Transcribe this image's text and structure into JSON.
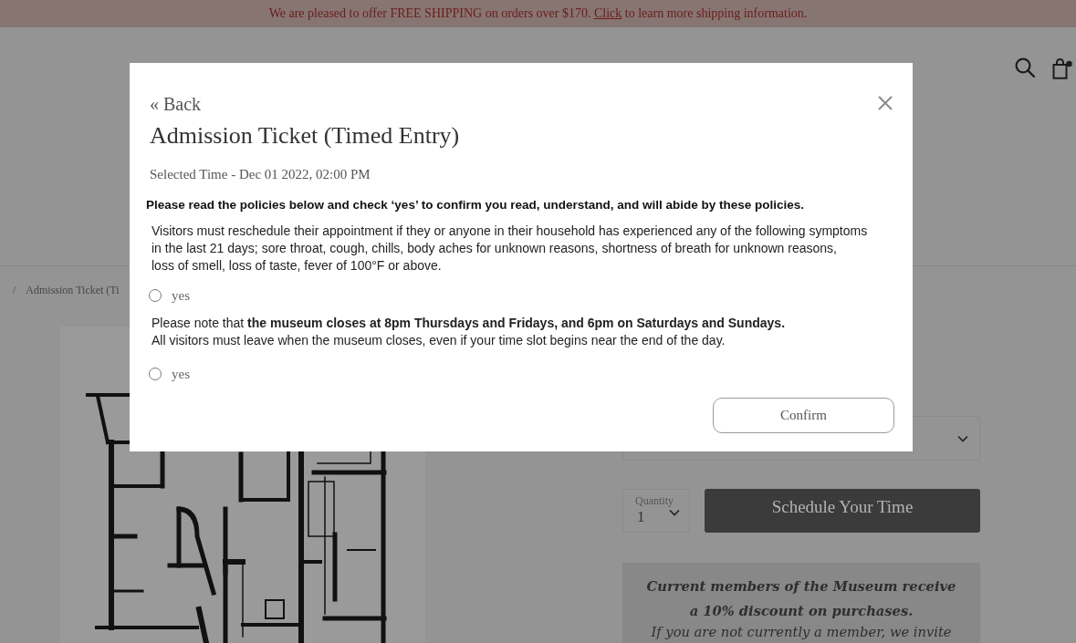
{
  "announcement": {
    "before": "We are pleased to offer FREE SHIPPING on orders over $170.",
    "link": "Click",
    "after": "to learn more shipping information."
  },
  "breadcrumb": {
    "separator": "/",
    "current": "Admission Ticket (Ti"
  },
  "product": {
    "quantity": {
      "label": "Quantity",
      "value": "1"
    },
    "schedule_button": "Schedule Your Time",
    "member_note": {
      "headline": "Current members of the Museum receive a 10% discount on purchases.",
      "text": "If you are not currently a member, we invite"
    }
  },
  "modal": {
    "back_link": "« Back",
    "title": "Admission Ticket (Timed Entry)",
    "selected_time": "Selected Time - Dec 01 2022, 02:00 PM",
    "instruction": "Please read the policies below and check ‘yes’ to confirm you read, understand, and will abide by these policies.",
    "policies": [
      {
        "text": "Visitors must reschedule their appointment if they or anyone in their household has experienced any of the following symptoms\nin the last 21 days; sore throat, cough, chills, body aches for unknown reasons, shortness of breath for unknown reasons,\nloss of smell, loss of taste, fever of 100°F or above.",
        "option_label": "yes",
        "checked": false
      },
      {
        "text": "Please note that **the museum closes at 8pm Thursdays and Fridays, and 6pm on Saturdays and Sundays.**\nAll visitors must leave when the museum closes, even if your time slot begins near the end of the day.",
        "option_label": "yes",
        "checked": false
      }
    ],
    "confirm_button": "Confirm"
  }
}
